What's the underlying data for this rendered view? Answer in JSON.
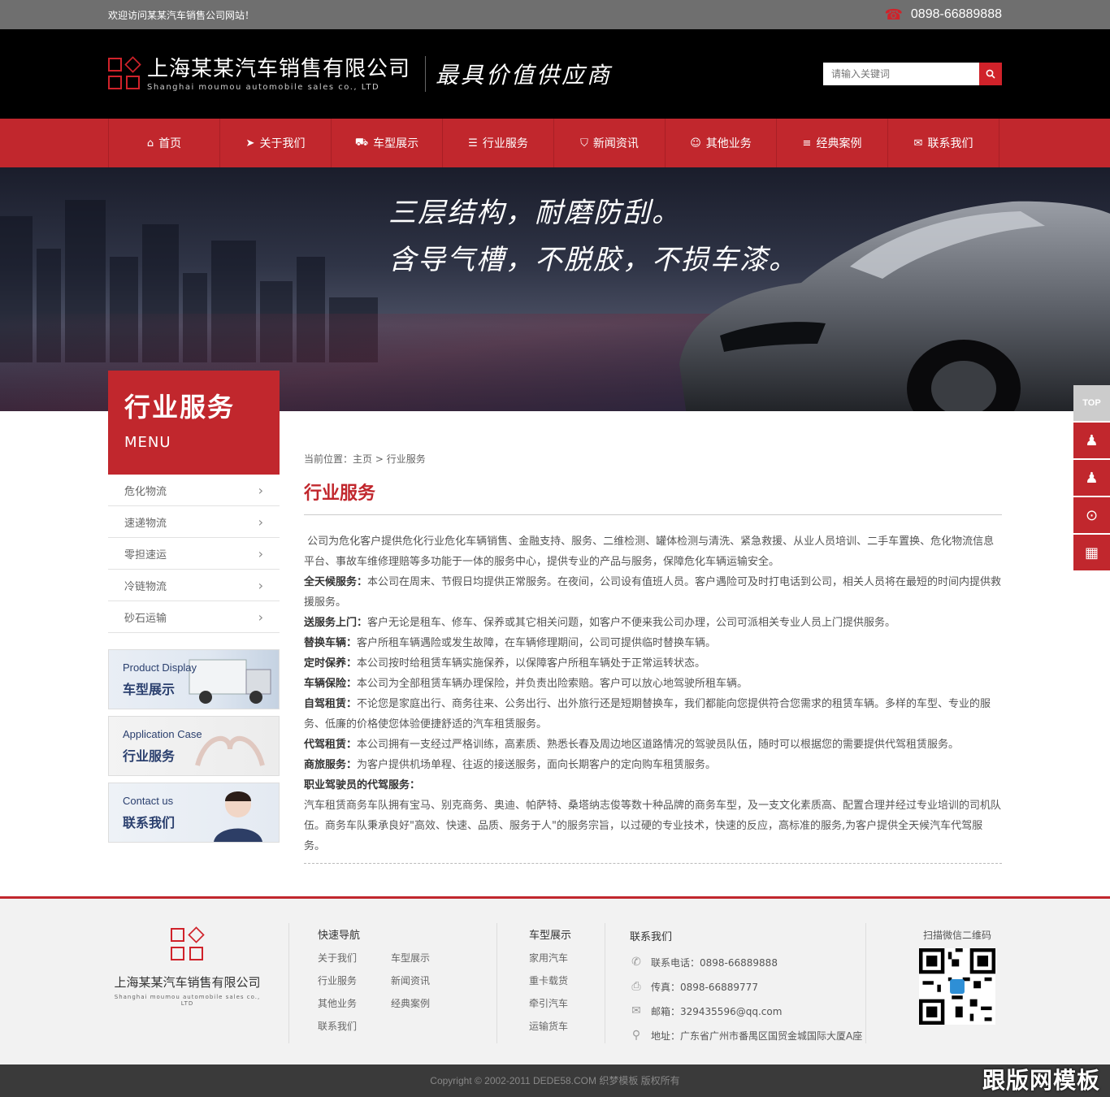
{
  "topbar": {
    "welcome": "欢迎访问某某汽车销售公司网站！",
    "phone": "0898-66889888"
  },
  "header": {
    "company_cn": "上海某某汽车销售有限公司",
    "company_en": "Shanghai moumou automobile sales co., LTD",
    "slogan": "最具价值供应商",
    "search_placeholder": "请输入关键词"
  },
  "nav": {
    "items": [
      {
        "label": "首页",
        "icon": "home-icon"
      },
      {
        "label": "关于我们",
        "icon": "send-icon"
      },
      {
        "label": "车型展示",
        "icon": "truck-icon"
      },
      {
        "label": "行业服务",
        "icon": "list-icon"
      },
      {
        "label": "新闻资讯",
        "icon": "cart-icon"
      },
      {
        "label": "其他业务",
        "icon": "user-icon"
      },
      {
        "label": "经典案例",
        "icon": "menu-icon"
      },
      {
        "label": "联系我们",
        "icon": "chat-icon"
      }
    ]
  },
  "banner": {
    "line1": "三层结构，耐磨防刮。",
    "line2": "含导气槽，不脱胶，不损车漆。"
  },
  "sidebar": {
    "title": "行业服务",
    "subtitle": "MENU",
    "menu": [
      "危化物流",
      "速递物流",
      "零担速运",
      "冷链物流",
      "砂石运输"
    ],
    "promos": [
      {
        "en": "Product Display",
        "cn": "车型展示"
      },
      {
        "en": "Application Case",
        "cn": "行业服务"
      },
      {
        "en": "Contact us",
        "cn": "联系我们"
      }
    ]
  },
  "content": {
    "crumb_prefix": "当前位置：",
    "crumb_home": "主页",
    "crumb_sep": ">",
    "crumb_current": "行业服务",
    "title": "行业服务",
    "intro": "公司为危化客户提供危化行业危化车辆销售、金融支持、服务、二维检测、罐体检测与清洗、紧急救援、从业人员培训、二手车置换、危化物流信息平台、事故车维修理赔等多功能于一体的服务中心，提供专业的产品与服务，保障危化车辆运输安全。",
    "items": [
      {
        "label": "全天候服务：",
        "text": "本公司在周末、节假日均提供正常服务。在夜间，公司设有值班人员。客户遇险可及时打电话到公司，相关人员将在最短的时间内提供救援服务。"
      },
      {
        "label": "送服务上门：",
        "text": "客户无论是租车、修车、保养或其它相关问题，如客户不便来我公司办理，公司可派相关专业人员上门提供服务。"
      },
      {
        "label": "替换车辆：",
        "text": "客户所租车辆遇险或发生故障，在车辆修理期间，公司可提供临时替换车辆。"
      },
      {
        "label": "定时保养：",
        "text": "本公司按时给租赁车辆实施保养，以保障客户所租车辆处于正常运转状态。"
      },
      {
        "label": "车辆保险：",
        "text": "本公司为全部租赁车辆办理保险，并负责出险索赔。客户可以放心地驾驶所租车辆。"
      },
      {
        "label": "自驾租赁：",
        "text": "不论您是家庭出行、商务往来、公务出行、出外旅行还是短期替换车，我们都能向您提供符合您需求的租赁车辆。多样的车型、专业的服务、低廉的价格使您体验便捷舒适的汽车租赁服务。"
      },
      {
        "label": "代驾租赁：",
        "text": "本公司拥有一支经过严格训练，高素质、熟悉长春及周边地区道路情况的驾驶员队伍，随时可以根据您的需要提供代驾租赁服务。"
      },
      {
        "label": "商旅服务：",
        "text": "为客户提供机场单程、往返的接送服务，面向长期客户的定向购车租赁服务。"
      },
      {
        "label": "职业驾驶员的代驾服务：",
        "text": ""
      }
    ],
    "closing": "汽车租赁商务车队拥有宝马、别克商务、奥迪、帕萨特、桑塔纳志俊等数十种品牌的商务车型，及一支文化素质高、配置合理并经过专业培训的司机队伍。商务车队秉承良好\"高效、快速、品质、服务于人\"的服务宗旨，以过硬的专业技术，快速的反应，高标准的服务,为客户提供全天候汽车代驾服务。"
  },
  "footer": {
    "company_cn": "上海某某汽车销售有限公司",
    "company_en": "Shanghai moumou automobile sales co., LTD",
    "quick_nav_title": "快速导航",
    "quick_nav": [
      "关于我们",
      "车型展示",
      "行业服务",
      "新闻资讯",
      "其他业务",
      "经典案例",
      "联系我们"
    ],
    "models_title": "车型展示",
    "models": [
      "家用汽车",
      "重卡载货",
      "牵引汽车",
      "运输货车"
    ],
    "contact_title": "联系我们",
    "tel": "联系电话：0898-66889888",
    "fax": "传真：0898-66889777",
    "email": "邮箱：329435596@qq.com",
    "address": "地址：广东省广州市番禺区国贸金城国际大厦A座",
    "qr_label": "扫描微信二维码",
    "copyright": "Copyright © 2002-2011 DEDE58.COM 织梦模板 版权所有",
    "watermark": "跟版网模板"
  },
  "float": {
    "top_label": "TOP"
  },
  "colors": {
    "brand_red": "#c1272d",
    "topbar": "#6f6f6f",
    "header": "#000000"
  }
}
